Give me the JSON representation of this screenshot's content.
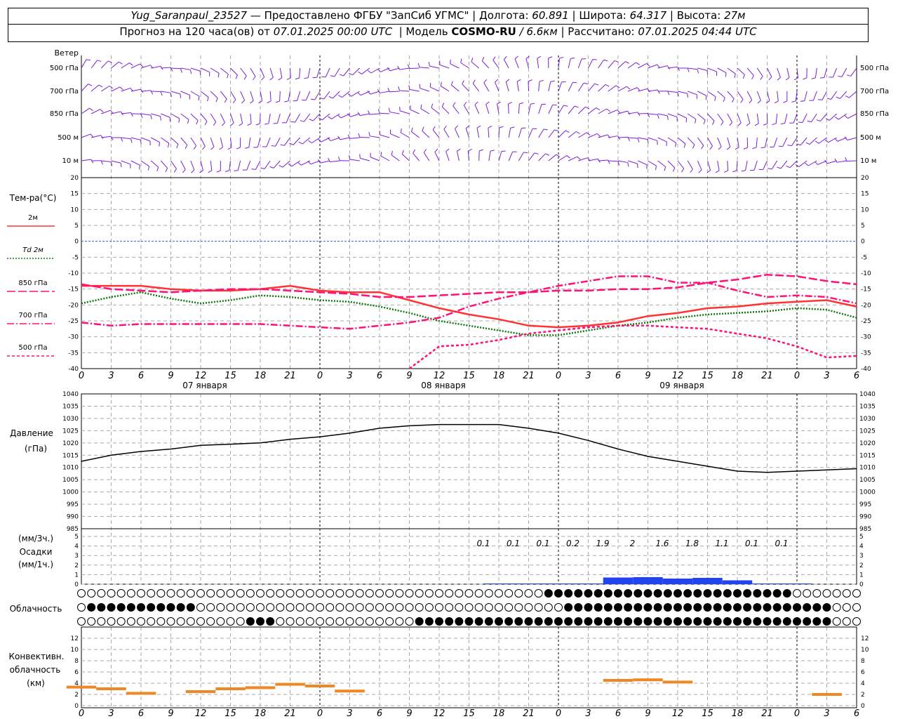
{
  "header": {
    "station": "Yug_Saranpaul_23527",
    "provider_sep": "—",
    "provider": "Предоставлено ФГБУ \"ЗапСиб УГМС\"",
    "lon_label": "Долгота:",
    "lon_value": "60.891",
    "lat_label": "Широта:",
    "lat_value": "64.317",
    "alt_label": "Высота:",
    "alt_value": "27м",
    "forecast_label": "Прогноз на 120 часа(ов) от",
    "forecast_time": "07.01.2025 00:00 UTC",
    "model_label": "Модель",
    "model_name": "COSMO-RU",
    "model_res": "/ 6.6км",
    "calc_label": "Рассчитано:",
    "calc_time": "07.01.2025 04:44 UTC"
  },
  "wind_panel": {
    "title": "Ветер",
    "levels": [
      "500 гПа",
      "700 гПа",
      "850 гПа",
      "500 м",
      "10  м"
    ],
    "color": "#7a1fd6"
  },
  "temp_panel": {
    "title": "Тем-ра(°С)",
    "legend": [
      {
        "label": "2м",
        "color": "#ff3333",
        "dash": "solid"
      },
      {
        "label": "Td  2м",
        "color": "#117711",
        "dash": "dot"
      },
      {
        "label": "850 гПа",
        "color": "#ff1177",
        "dash": "long"
      },
      {
        "label": "700 гПа",
        "color": "#ff1177",
        "dash": "dashdot"
      },
      {
        "label": "500 гПа",
        "color": "#ff1177",
        "dash": "short"
      }
    ],
    "y_ticks": [
      "20",
      "15",
      "10",
      "5",
      "0",
      "-5",
      "-10",
      "-15",
      "-20",
      "-25",
      "-30",
      "-35",
      "-40"
    ],
    "zero_line_color": "#3355ff"
  },
  "pressure_panel": {
    "title": "Давление",
    "unit": "(гПа)",
    "y_ticks": [
      "1040",
      "1035",
      "1030",
      "1025",
      "1020",
      "1015",
      "1010",
      "1005",
      "1000",
      "995",
      "990",
      "985"
    ]
  },
  "precip_panel": {
    "label_top": "(мм/3ч.)",
    "title": "Осадки",
    "label_bottom": "(мм/1ч.)",
    "y_ticks": [
      "5",
      "4",
      "3",
      "2",
      "1",
      "0"
    ],
    "totals": [
      "0.1",
      "0.1",
      "0.1",
      "0.2",
      "1.9",
      "2",
      "1.6",
      "1.8",
      "1.1",
      "0.1",
      "0.1"
    ],
    "bar_color": "#2244ee"
  },
  "cloud_panel": {
    "title": "Облачность"
  },
  "conv_panel": {
    "title_1": "Конвективн.",
    "title_2": "облачность",
    "unit": "(км)",
    "y_ticks": [
      "12",
      "10",
      "8",
      "6",
      "4",
      "2",
      "0"
    ],
    "bar_color": "#ee8822"
  },
  "time_axis": {
    "hour_labels": [
      "0",
      "3",
      "6",
      "9",
      "12",
      "15",
      "18",
      "21",
      "0",
      "3",
      "6",
      "9",
      "12",
      "15",
      "18",
      "21",
      "0",
      "3",
      "6",
      "9",
      "12",
      "15",
      "18",
      "21",
      "0",
      "3",
      "6"
    ],
    "day_labels": [
      "07 января",
      "08 января",
      "09 января"
    ]
  },
  "chart_data": {
    "type": "line",
    "x_hours": [
      0,
      3,
      6,
      9,
      12,
      15,
      18,
      21,
      24,
      27,
      30,
      33,
      36,
      39,
      42,
      45,
      48,
      51,
      54,
      57,
      60,
      63,
      66,
      69,
      72,
      75,
      78
    ],
    "series": [
      {
        "name": "2м",
        "values": [
          -14,
          -14,
          -14,
          -15,
          -15.5,
          -15.5,
          -15,
          -14,
          -15.5,
          -16,
          -16,
          -18.5,
          -21,
          -23,
          -24.5,
          -26.5,
          -27,
          -26.5,
          -25.5,
          -23.5,
          -22.5,
          -21,
          -20.5,
          -19.5,
          -19,
          -18.5,
          -20.5
        ]
      },
      {
        "name": "Td  2м",
        "values": [
          -19.5,
          -17.5,
          -16,
          -18,
          -19.5,
          -18.5,
          -17,
          -17.5,
          -18.5,
          -19,
          -20.5,
          -22.5,
          -25,
          -26.5,
          -28,
          -29.5,
          -29.5,
          -28,
          -26.5,
          -25.5,
          -24,
          -23,
          -22.5,
          -22,
          -21,
          -21.5,
          -24
        ]
      },
      {
        "name": "850 гПа",
        "values": [
          -13.5,
          -15,
          -15.5,
          -16,
          -15.5,
          -15,
          -15,
          -15.5,
          -16,
          -16.5,
          -17.5,
          -17.5,
          -17,
          -16.5,
          -16,
          -16,
          -15.5,
          -15.5,
          -15,
          -15,
          -14.5,
          -13,
          -12,
          -10.5,
          -11,
          -12.5,
          -13.5
        ]
      },
      {
        "name": "700 гПа",
        "values": [
          -25.5,
          -26.5,
          -26,
          -26,
          -26,
          -26,
          -26,
          -26.5,
          -27,
          -27.5,
          -26.5,
          -25.5,
          -24,
          -20.5,
          -18,
          -16,
          -14,
          -12.5,
          -11,
          -11,
          -13,
          -13,
          -15.5,
          -17.5,
          -17,
          -17.5,
          -19.5
        ]
      },
      {
        "name": "500 гПа",
        "x_start": 33,
        "values": [
          -40,
          -33,
          -32.5,
          -31,
          -29,
          -28,
          -27,
          -26.5,
          -26.5,
          -27,
          -27.5,
          -29,
          -30.5,
          -33,
          -36.5,
          -36
        ]
      }
    ],
    "pressure": {
      "name": "Давление",
      "values": [
        1012.5,
        1015,
        1016.5,
        1017.5,
        1019,
        1019.5,
        1020,
        1021.5,
        1022.5,
        1024,
        1026,
        1027,
        1027.5,
        1027.5,
        1027.5,
        1026,
        1024,
        1021,
        1017.5,
        1014.5,
        1012.5,
        1010.5,
        1008.5,
        1008,
        1008.5,
        1009,
        1009.5
      ]
    },
    "precip_mm_per_3h": [
      0,
      0,
      0,
      0,
      0,
      0,
      0,
      0,
      0,
      0,
      0,
      0,
      0,
      0,
      0.1,
      0.1,
      0.1,
      0.2,
      1.9,
      2,
      1.6,
      1.8,
      1.1,
      0.1,
      0.1,
      0,
      0
    ],
    "convective_cloud_km": [
      3.3,
      3,
      2.2,
      0,
      2.5,
      3,
      3.2,
      3.8,
      3.5,
      2.6,
      0,
      0,
      0,
      0,
      0,
      0,
      0,
      0,
      4.5,
      4.6,
      4.2,
      0,
      0,
      0,
      0,
      2,
      0
    ],
    "xlim": [
      0,
      78
    ],
    "temp_ylim": [
      -40,
      20
    ],
    "pressure_ylim": [
      985,
      1040
    ],
    "grid": true
  }
}
